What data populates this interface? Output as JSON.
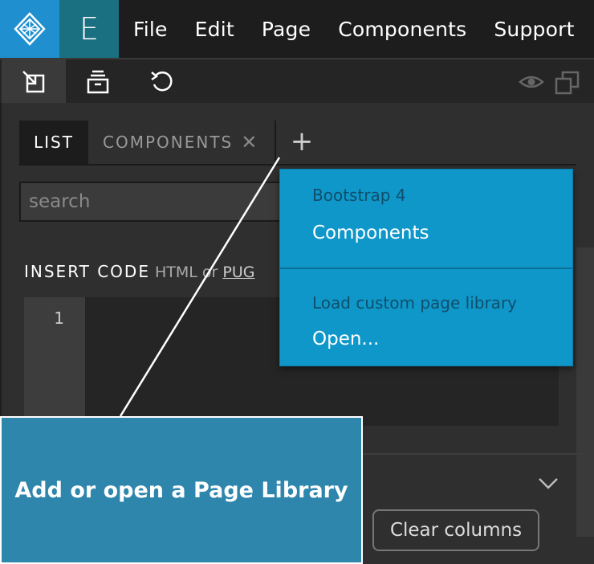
{
  "app": {
    "editor_letter": "E",
    "menu": [
      "File",
      "Edit",
      "Page",
      "Components",
      "Support"
    ]
  },
  "toolbar": {
    "tools": [
      "import-icon",
      "library-icon",
      "undo-icon"
    ],
    "right_tools": [
      "eye-icon",
      "duplicate-icon"
    ]
  },
  "panel": {
    "tabs": {
      "list_label": "LIST",
      "components_label": "COMPONENTS",
      "close_glyph": "✕",
      "add_glyph": "+"
    },
    "search": {
      "placeholder": "search",
      "value": ""
    },
    "insert_code": {
      "label": "INSERT CODE",
      "html": "HTML",
      "or": "or",
      "pug": "PUG"
    },
    "code_editor": {
      "line_numbers": [
        "1"
      ]
    },
    "clear_columns_label": "Clear columns"
  },
  "dropdown": {
    "section1_header": "Bootstrap 4",
    "section1_item": "Components",
    "section2_header": "Load custom page library",
    "section2_item": "Open..."
  },
  "callout": {
    "text": "Add or open a Page Library"
  },
  "colors": {
    "logo_bg": "#1f8fcf",
    "editor_tab_bg": "#1a6f80",
    "dropdown_bg": "#0f97c9",
    "callout_bg": "#2f86ac"
  }
}
